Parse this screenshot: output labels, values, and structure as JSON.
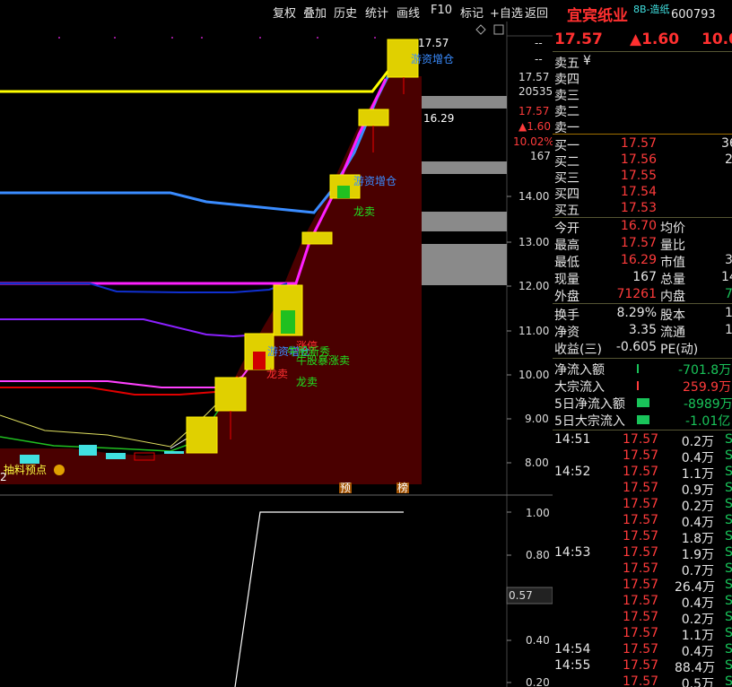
{
  "toolbar": {
    "items": [
      "复权",
      "叠加",
      "历史",
      "统计",
      "画线",
      "F10",
      "标记",
      "+自选",
      "返回"
    ]
  },
  "stock": {
    "name": "宜宾纸业",
    "tag": "8B-造纸",
    "code": "600793",
    "price": "17.57",
    "change": "▲1.60",
    "pct": "10.0"
  },
  "price_axis": [
    "14.00",
    "13.00",
    "12.00",
    "11.00",
    "10.00",
    "9.00",
    "8.00"
  ],
  "right_panel": [
    "--",
    "--",
    "17.57",
    "20535",
    "17.57",
    "▲1.60",
    "10.02%",
    "167"
  ],
  "chart_labels": {
    "high": "17.57",
    "low": "16.29",
    "bottom_left": "2",
    "marker_a": "预",
    "marker_b": "榜",
    "event_text": "抽料预点"
  },
  "annotations": {
    "a1": "游资增仓",
    "a2": "游资增仓",
    "a3": "龙卖",
    "a4": "涨停",
    "a5": "游资增仓",
    "a6": "牛股新秀",
    "a7": "牛股暴涨卖",
    "a8": "龙卖",
    "a9": "龙卖"
  },
  "indicator": {
    "axis": [
      "1.00",
      "0.80",
      "0.57",
      "0.40",
      "0.20"
    ],
    "current": "0.57"
  },
  "orderbook": {
    "sell": [
      {
        "label": "卖五",
        "price": "",
        "vol": ""
      },
      {
        "label": "卖四",
        "price": "",
        "vol": ""
      },
      {
        "label": "卖三",
        "price": "",
        "vol": ""
      },
      {
        "label": "卖二",
        "price": "",
        "vol": ""
      },
      {
        "label": "卖一",
        "price": "",
        "vol": ""
      }
    ],
    "sell_unit": "¥",
    "buy": [
      {
        "label": "买一",
        "price": "17.57",
        "vol": "36"
      },
      {
        "label": "买二",
        "price": "17.56",
        "vol": "2"
      },
      {
        "label": "买三",
        "price": "17.55",
        "vol": ""
      },
      {
        "label": "买四",
        "price": "17.54",
        "vol": ""
      },
      {
        "label": "买五",
        "price": "17.53",
        "vol": ""
      }
    ]
  },
  "quote": [
    {
      "l1": "今开",
      "v1": "16.70",
      "l2": "均价",
      "v2": ""
    },
    {
      "l1": "最高",
      "v1": "17.57",
      "l2": "量比",
      "v2": ""
    },
    {
      "l1": "最低",
      "v1": "16.29",
      "l2": "市值",
      "v2": "3"
    },
    {
      "l1": "现量",
      "v1": "167",
      "l2": "总量",
      "v2": "14"
    },
    {
      "l1": "外盘",
      "v1": "71261",
      "l2": "内盘",
      "v2": "7"
    }
  ],
  "quote2": [
    {
      "l1": "换手",
      "v1": "8.29%",
      "l2": "股本",
      "v2": "1"
    },
    {
      "l1": "净资",
      "v1": "3.35",
      "l2": "流通",
      "v2": "1"
    },
    {
      "l1": "收益(三)",
      "v1": "-0.605",
      "l2": "PE(动)",
      "v2": ""
    }
  ],
  "flows": [
    {
      "label": "净流入额",
      "value": "-701.8万",
      "color": "#19c45a"
    },
    {
      "label": "大宗流入",
      "value": "259.9万",
      "color": "#ff3b3b"
    },
    {
      "label": "5日净流入额",
      "value": "-8989万",
      "color": "#19c45a"
    },
    {
      "label": "5日大宗流入",
      "value": "-1.01亿",
      "color": "#19c45a"
    }
  ],
  "ticks": [
    {
      "time": "14:51",
      "price": "17.57",
      "vol": "0.2万",
      "side": "S"
    },
    {
      "time": "",
      "price": "17.57",
      "vol": "0.4万",
      "side": "S"
    },
    {
      "time": "14:52",
      "price": "17.57",
      "vol": "1.1万",
      "side": "S"
    },
    {
      "time": "",
      "price": "17.57",
      "vol": "0.9万",
      "side": "S"
    },
    {
      "time": "",
      "price": "17.57",
      "vol": "0.2万",
      "side": "S"
    },
    {
      "time": "",
      "price": "17.57",
      "vol": "0.4万",
      "side": "S"
    },
    {
      "time": "",
      "price": "17.57",
      "vol": "1.8万",
      "side": "S"
    },
    {
      "time": "14:53",
      "price": "17.57",
      "vol": "1.9万",
      "side": "S"
    },
    {
      "time": "",
      "price": "17.57",
      "vol": "0.7万",
      "side": "S"
    },
    {
      "time": "",
      "price": "17.57",
      "vol": "26.4万",
      "side": "S"
    },
    {
      "time": "",
      "price": "17.57",
      "vol": "0.4万",
      "side": "S"
    },
    {
      "time": "",
      "price": "17.57",
      "vol": "0.2万",
      "side": "S"
    },
    {
      "time": "",
      "price": "17.57",
      "vol": "1.1万",
      "side": "S"
    },
    {
      "time": "14:54",
      "price": "17.57",
      "vol": "0.4万",
      "side": "S"
    },
    {
      "time": "14:55",
      "price": "17.57",
      "vol": "88.4万",
      "side": "S"
    },
    {
      "time": "",
      "price": "17.57",
      "vol": "0.5万",
      "side": "S"
    }
  ]
}
